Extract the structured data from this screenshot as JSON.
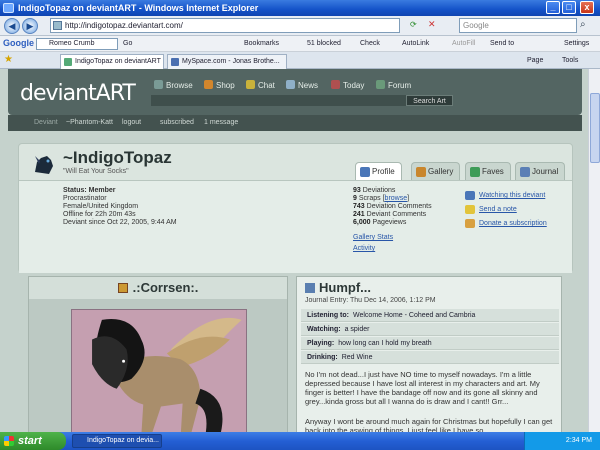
{
  "window": {
    "title": "IndigoTopaz on deviantART - Windows Internet Explorer",
    "controls": [
      "_",
      "□",
      "x"
    ]
  },
  "address": {
    "url": "http://indigotopaz.deviantart.com/",
    "search_placeholder": "Google"
  },
  "google_toolbar": {
    "logo": "Google",
    "query": "Romeo Crumb",
    "go": "Go",
    "items": [
      "Bookmarks",
      "51 blocked",
      "Check",
      "AutoLink",
      "AutoFill",
      "Send to",
      "Settings"
    ]
  },
  "tabs": [
    {
      "label": "IndigoTopaz on deviantART",
      "active": true
    },
    {
      "label": "MySpace.com - Jonas Brothe...",
      "active": false
    }
  ],
  "browser_tools": [
    "Page",
    "Tools"
  ],
  "da": {
    "logo": "deviantART",
    "nav": [
      {
        "label": "Browse",
        "color": "#7a9b96"
      },
      {
        "label": "Shop",
        "color": "#d2862c"
      },
      {
        "label": "Chat",
        "color": "#c9b23b"
      },
      {
        "label": "News",
        "color": "#8fb0c8"
      },
      {
        "label": "Today",
        "color": "#b05050"
      },
      {
        "label": "Forum",
        "color": "#6a9a7a"
      }
    ],
    "search_button": "Search Art",
    "userbar": {
      "deviant": "Deviant",
      "username": "~Phantom-Katt",
      "logout": "logout",
      "subscribed": "subscribed",
      "messages": "1 message"
    }
  },
  "profile": {
    "username": "~IndigoTopaz",
    "tagline": "\"Will Eat Your Socks\"",
    "tabs": [
      {
        "label": "Profile",
        "color": "#4a76b8",
        "active": true
      },
      {
        "label": "Gallery",
        "color": "#c9862c",
        "active": false
      },
      {
        "label": "Faves",
        "color": "#3e9c58",
        "active": false
      },
      {
        "label": "Journal",
        "color": "#5b7fb5",
        "active": false
      }
    ],
    "status_label": "Status: Member",
    "info": [
      "Procrastinator",
      "Female/United Kingdom",
      "Offline for 22h 20m 43s",
      "Deviant since Oct 22, 2005, 9:44 AM"
    ],
    "stats": [
      {
        "num": "93",
        "label": "Deviations"
      },
      {
        "num": "9",
        "label": "Scraps",
        "link": "browse"
      },
      {
        "num": "743",
        "label": "Deviation Comments"
      },
      {
        "num": "241",
        "label": "Deviant Comments"
      },
      {
        "num": "6,000",
        "label": "Pageviews"
      }
    ],
    "links": [
      "Gallery Stats",
      "Activity"
    ],
    "actions": [
      {
        "label": "Watching this deviant",
        "icon": "eye-icon",
        "color": "#4a76b8"
      },
      {
        "label": "Send a note",
        "icon": "note-icon",
        "color": "#e2c43a"
      },
      {
        "label": "Donate a subscription",
        "icon": "gift-icon",
        "color": "#d8a040"
      }
    ]
  },
  "deviation": {
    "title": ".:Corrsen:."
  },
  "journal": {
    "title": "Humpf...",
    "date": "Journal Entry: Thu Dec 14, 2006, 1:12 PM",
    "rows": [
      {
        "label": "Listening to:",
        "value": "Welcome Home - Coheed and Cambria"
      },
      {
        "label": "Watching:",
        "value": "a spider"
      },
      {
        "label": "Playing:",
        "value": "how long can I hold my breath"
      },
      {
        "label": "Drinking:",
        "value": "Red Wine"
      }
    ],
    "para1": "No I'm not dead...I just have NO time to myself nowadays. I'm a little depressed because I have lost all interest in my characters and art. My finger is better! I have the bandage off now and its gone all skinny and grey...kinda gross but all I wanna do is draw and I cant!! Grr...",
    "para2": "Anyway I wont be around much again for Christmas but hopefully I can get back into the aswing of things. I just feel like I have so"
  },
  "taskbar": {
    "start": "start",
    "item": "IndigoTopaz on devia...",
    "clock": "2:34 PM"
  }
}
